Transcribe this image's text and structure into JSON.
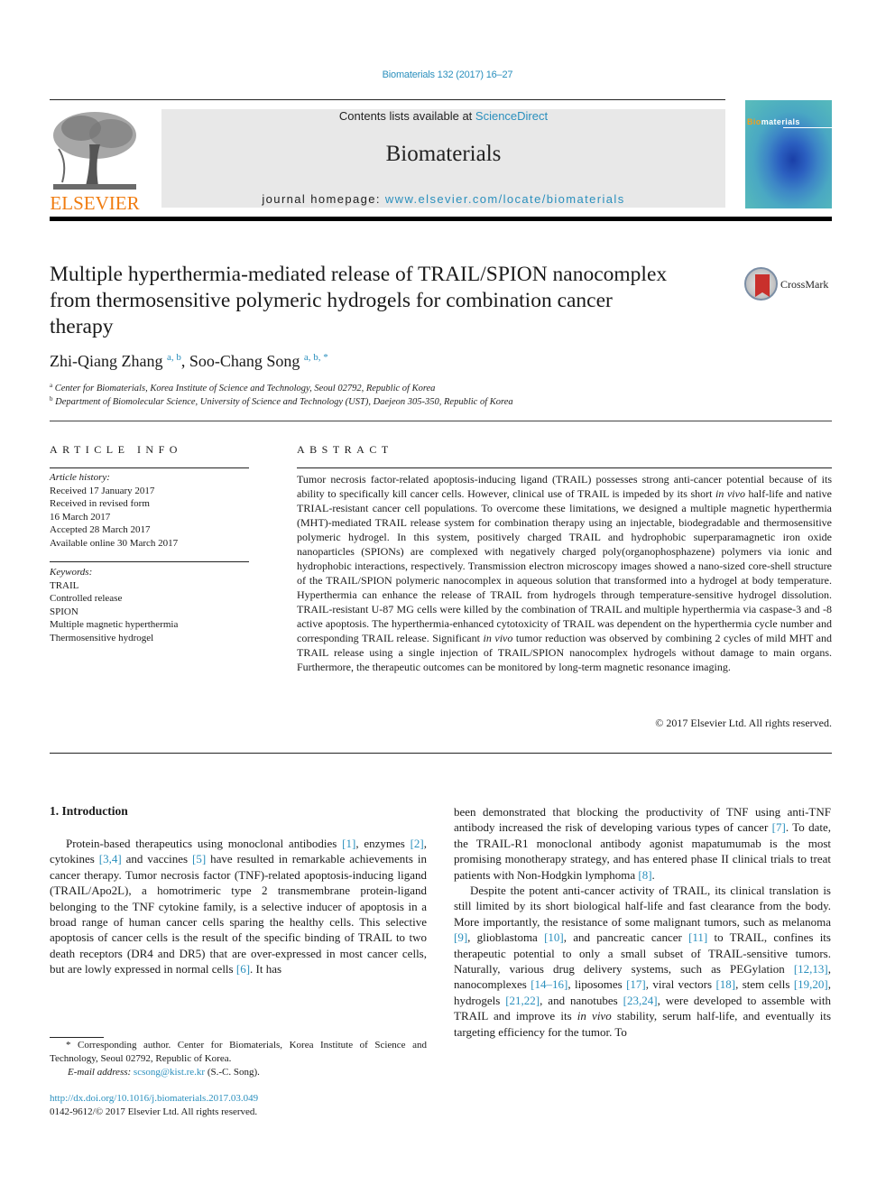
{
  "header": {
    "citation": "Biomaterials 132 (2017) 16–27",
    "publisher_logo_text": "ELSEVIER",
    "contents_prefix": "Contents lists available at ",
    "contents_link": "ScienceDirect",
    "journal_name": "Biomaterials",
    "homepage_prefix": "journal homepage: ",
    "homepage_link": "www.elsevier.com/locate/biomaterials",
    "cover_title_bi": "Bio",
    "cover_title_rest": "materials"
  },
  "article": {
    "title": "Multiple hyperthermia-mediated release of TRAIL/SPION nanocomplex from thermosensitive polymeric hydrogels for combination cancer therapy",
    "crossmark_label": "CrossMark",
    "authors": [
      {
        "name": "Zhi-Qiang Zhang",
        "sup": "a, b"
      },
      {
        "name": "Soo-Chang Song",
        "sup": "a, b, *"
      }
    ],
    "author_separator": ", ",
    "affiliations": [
      {
        "key": "a",
        "text": "Center for Biomaterials, Korea Institute of Science and Technology, Seoul 02792, Republic of Korea"
      },
      {
        "key": "b",
        "text": "Department of Biomolecular Science, University of Science and Technology (UST), Daejeon 305-350, Republic of Korea"
      }
    ]
  },
  "article_info": {
    "heading": "ARTICLE INFO",
    "history_label": "Article history:",
    "history": [
      "Received 17 January 2017",
      "Received in revised form",
      "16 March 2017",
      "Accepted 28 March 2017",
      "Available online 30 March 2017"
    ],
    "keywords_label": "Keywords:",
    "keywords": [
      "TRAIL",
      "Controlled release",
      "SPION",
      "Multiple magnetic hyperthermia",
      "Thermosensitive hydrogel"
    ]
  },
  "abstract": {
    "heading": "ABSTRACT",
    "p1": "Tumor necrosis factor-related apoptosis-inducing ligand (TRAIL) possesses strong anti-cancer potential because of its ability to specifically kill cancer cells. However, clinical use of TRAIL is impeded by its short ",
    "p1_italic": "in vivo",
    "p2": " half-life and native TRIAL-resistant cancer cell populations. To overcome these limitations, we designed a multiple magnetic hyperthermia (MHT)-mediated TRAIL release system for combination therapy using an injectable, biodegradable and thermosensitive polymeric hydrogel. In this system, positively charged TRAIL and hydrophobic superparamagnetic iron oxide nanoparticles (SPIONs) are complexed with negatively charged poly(organophosphazene) polymers via ionic and hydrophobic interactions, respectively. Transmission electron microscopy images showed a nano-sized core-shell structure of the TRAIL/SPION polymeric nanocomplex in aqueous solution that transformed into a hydrogel at body temperature. Hyperthermia can enhance the release of TRAIL from hydrogels through temperature-sensitive hydrogel dissolution. TRAIL-resistant U-87 MG cells were killed by the combination of TRAIL and multiple hyperthermia via caspase-3 and -8 active apoptosis. The hyperthermia-enhanced cytotoxicity of TRAIL was dependent on the hyperthermia cycle number and corresponding TRAIL release. Significant ",
    "p2_italic": "in vivo",
    "p3": " tumor reduction was observed by combining 2 cycles of mild MHT and TRAIL release using a single injection of TRAIL/SPION nanocomplex hydrogels without damage to main organs. Furthermore, the therapeutic outcomes can be monitored by long-term magnetic resonance imaging.",
    "copyright": "© 2017 Elsevier Ltd. All rights reserved."
  },
  "introduction": {
    "heading": "1.  Introduction",
    "left": [
      {
        "t": "Protein-based therapeutics using monoclonal antibodies "
      },
      {
        "ref": "[1]"
      },
      {
        "t": ", enzymes "
      },
      {
        "ref": "[2]"
      },
      {
        "t": ", cytokines "
      },
      {
        "ref": "[3,4]"
      },
      {
        "t": " and vaccines "
      },
      {
        "ref": "[5]"
      },
      {
        "t": " have resulted in remarkable achievements in cancer therapy. Tumor necrosis factor (TNF)-related apoptosis-inducing ligand (TRAIL/Apo2L), a homotrimeric type 2 transmembrane protein-ligand belonging to the TNF cytokine family, is a selective inducer of apoptosis in a broad range of human cancer cells sparing the healthy cells. This selective apoptosis of cancer cells is the result of the specific binding of TRAIL to two death receptors (DR4 and DR5) that are over-expressed in most cancer cells, but are lowly expressed in normal cells "
      },
      {
        "ref": "[6]"
      },
      {
        "t": ". It has"
      }
    ],
    "right_p1": [
      {
        "t": "been demonstrated that blocking the productivity of TNF using anti-TNF antibody increased the risk of developing various types of cancer "
      },
      {
        "ref": "[7]"
      },
      {
        "t": ". To date, the TRAIL-R1 monoclonal antibody agonist mapatumumab is the most promising monotherapy strategy, and has entered phase II clinical trials to treat patients with Non-Hodgkin lymphoma "
      },
      {
        "ref": "[8]"
      },
      {
        "t": "."
      }
    ],
    "right_p2": [
      {
        "t": "Despite the potent anti-cancer activity of TRAIL, its clinical translation is still limited by its short biological half-life and fast clearance from the body. More importantly, the resistance of some malignant tumors, such as melanoma "
      },
      {
        "ref": "[9]"
      },
      {
        "t": ", glioblastoma "
      },
      {
        "ref": "[10]"
      },
      {
        "t": ", and pancreatic cancer "
      },
      {
        "ref": "[11]"
      },
      {
        "t": " to TRAIL, confines its therapeutic potential to only a small subset of TRAIL-sensitive tumors. Naturally, various drug delivery systems, such as PEGylation "
      },
      {
        "ref": "[12,13]"
      },
      {
        "t": ", nanocomplexes "
      },
      {
        "ref": "[14–16]"
      },
      {
        "t": ", liposomes "
      },
      {
        "ref": "[17]"
      },
      {
        "t": ", viral vectors "
      },
      {
        "ref": "[18]"
      },
      {
        "t": ", stem cells "
      },
      {
        "ref": "[19,20]"
      },
      {
        "t": ", hydrogels "
      },
      {
        "ref": "[21,22]"
      },
      {
        "t": ", and nanotubes "
      },
      {
        "ref": "[23,24]"
      },
      {
        "t": ", were developed to assemble with TRAIL and improve its "
      },
      {
        "i": "in vivo"
      },
      {
        "t": " stability, serum half-life, and eventually its targeting efficiency for the tumor. To"
      }
    ]
  },
  "footnote": {
    "corresponding": "* Corresponding author. Center for Biomaterials, Korea Institute of Science and Technology, Seoul 02792, Republic of Korea.",
    "email_label": "E-mail address: ",
    "email": "scsong@kist.re.kr",
    "email_suffix": " (S.-C. Song).",
    "doi": "http://dx.doi.org/10.1016/j.biomaterials.2017.03.049",
    "issn": "0142-9612/© 2017 Elsevier Ltd. All rights reserved."
  },
  "colors": {
    "link": "#2a8fbd",
    "elsevier_orange": "#f07c10",
    "banner_bg": "#e8e8e8"
  }
}
